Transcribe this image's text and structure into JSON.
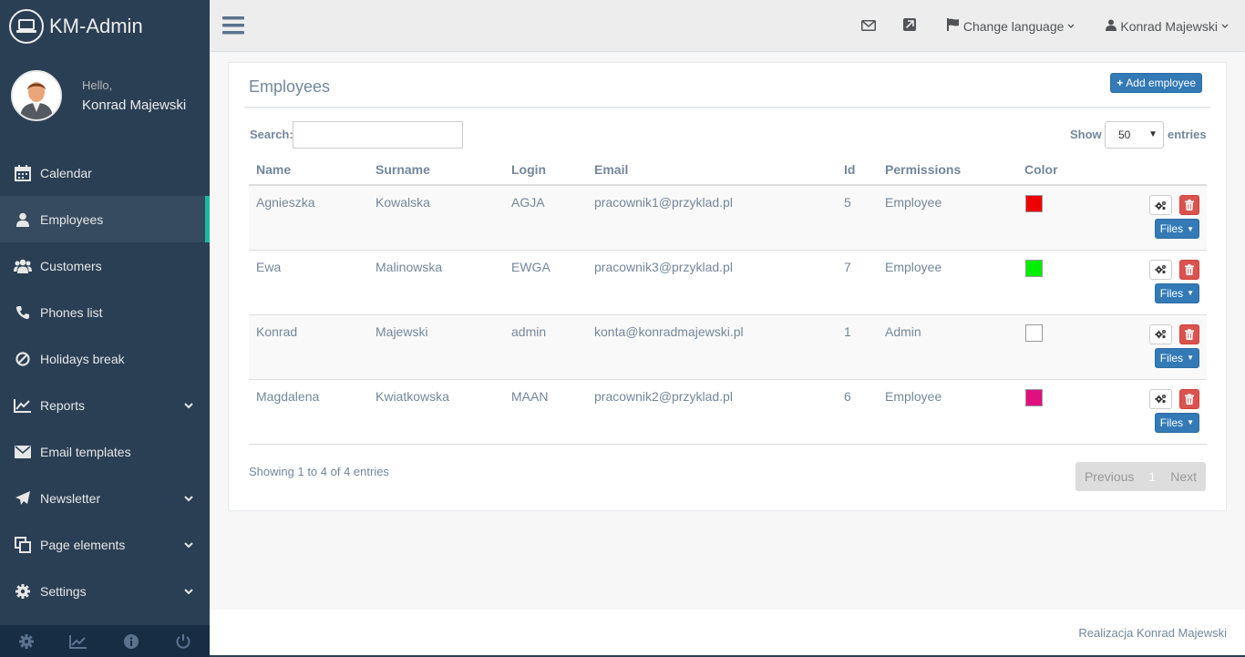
{
  "brand": {
    "title": "KM-Admin"
  },
  "profile": {
    "greeting": "Hello,",
    "name": "Konrad Majewski"
  },
  "sidebar": {
    "items": [
      {
        "label": "Calendar",
        "icon": "calendar-icon",
        "active": false,
        "has_submenu": false
      },
      {
        "label": "Employees",
        "icon": "user-icon",
        "active": true,
        "has_submenu": false
      },
      {
        "label": "Customers",
        "icon": "users-icon",
        "active": false,
        "has_submenu": false
      },
      {
        "label": "Phones list",
        "icon": "phone-icon",
        "active": false,
        "has_submenu": false
      },
      {
        "label": "Holidays break",
        "icon": "ban-icon",
        "active": false,
        "has_submenu": false
      },
      {
        "label": "Reports",
        "icon": "line-chart-icon",
        "active": false,
        "has_submenu": true
      },
      {
        "label": "Email templates",
        "icon": "envelope-icon",
        "active": false,
        "has_submenu": false
      },
      {
        "label": "Newsletter",
        "icon": "paper-plane-icon",
        "active": false,
        "has_submenu": true
      },
      {
        "label": "Page elements",
        "icon": "clone-icon",
        "active": false,
        "has_submenu": true
      },
      {
        "label": "Settings",
        "icon": "cog-icon",
        "active": false,
        "has_submenu": true
      }
    ],
    "footer_icons": [
      "settings-icon",
      "chart-icon",
      "info-icon",
      "power-icon"
    ]
  },
  "topnav": {
    "language_label": "Change language",
    "user_label": "Konrad Majewski"
  },
  "panel": {
    "title": "Employees",
    "add_button": "Add employee",
    "search_label": "Search:",
    "search_value": "",
    "show_label": "Show",
    "show_value": "50",
    "entries_label": "entries"
  },
  "table": {
    "columns": [
      "Name",
      "Surname",
      "Login",
      "Email",
      "Id",
      "Permissions",
      "Color"
    ],
    "rows": [
      {
        "name": "Agnieszka",
        "surname": "Kowalska",
        "login": "AGJA",
        "email": "pracownik1@przyklad.pl",
        "id": "5",
        "permissions": "Employee",
        "color": "#ee0000"
      },
      {
        "name": "Ewa",
        "surname": "Malinowska",
        "login": "EWGA",
        "email": "pracownik3@przyklad.pl",
        "id": "7",
        "permissions": "Employee",
        "color": "#00ee00"
      },
      {
        "name": "Konrad",
        "surname": "Majewski",
        "login": "admin",
        "email": "konta@konradmajewski.pl",
        "id": "1",
        "permissions": "Admin",
        "color": "#ffffff"
      },
      {
        "name": "Magdalena",
        "surname": "Kwiatkowska",
        "login": "MAAN",
        "email": "pracownik2@przyklad.pl",
        "id": "6",
        "permissions": "Employee",
        "color": "#e0117f"
      }
    ],
    "files_label": "Files"
  },
  "pagination": {
    "info": "Showing 1 to 4 of 4 entries",
    "previous": "Previous",
    "current": "1",
    "next": "Next"
  },
  "footer": {
    "text": "Realizacja Konrad Majewski"
  }
}
